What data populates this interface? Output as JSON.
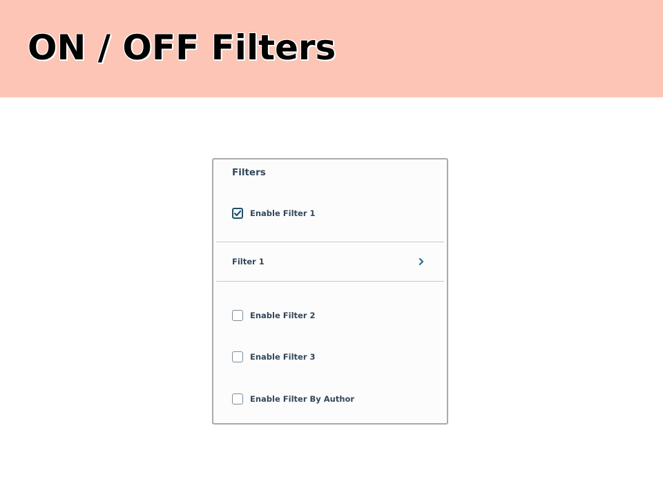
{
  "slide": {
    "title": "ON / OFF Filters",
    "header_color": "#fcc5b5"
  },
  "panel": {
    "heading": "Filters",
    "accent_color": "#1f4f66",
    "text_color": "#33475b",
    "options": [
      {
        "label": "Enable Filter 1",
        "checked": true
      },
      {
        "label": "Enable Filter 2",
        "checked": false
      },
      {
        "label": "Enable Filter 3",
        "checked": false
      },
      {
        "label": "Enable Filter By Author",
        "checked": false
      }
    ],
    "expandable_row": {
      "label": "Filter 1",
      "icon": "chevron-right-icon"
    }
  }
}
